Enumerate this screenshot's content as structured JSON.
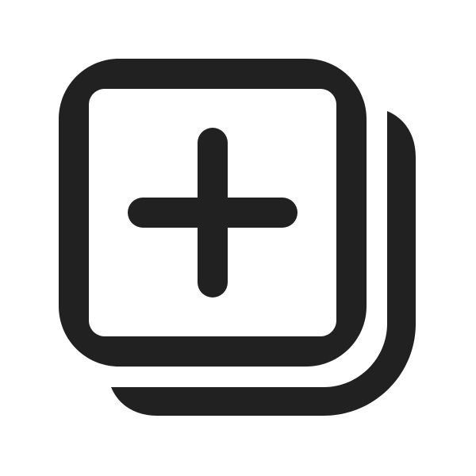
{
  "icon": {
    "name": "add-square-multiple-icon",
    "color": "#212121",
    "background": "#ffffff"
  }
}
